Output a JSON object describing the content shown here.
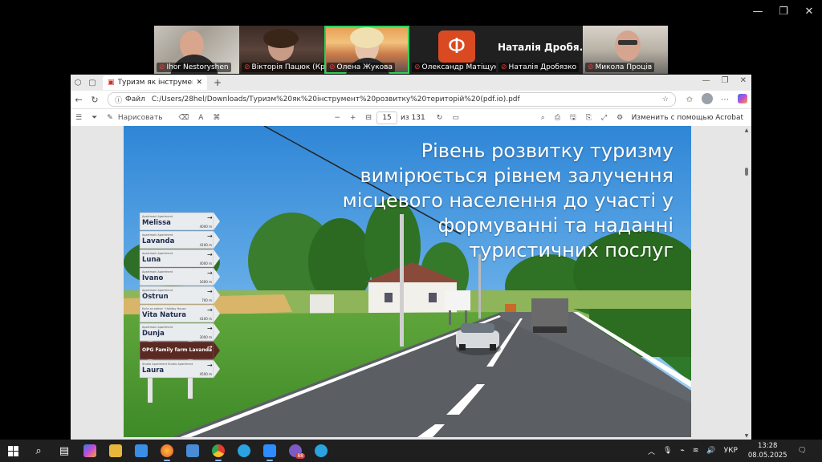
{
  "participants": [
    {
      "name": "Ihor Nestoryshen",
      "muted": true
    },
    {
      "name": "Вікторія Пацюк (Крив...",
      "muted": true
    },
    {
      "name": "Олена Жукова",
      "muted": true,
      "active": true
    },
    {
      "name": "Олександр Матіщук",
      "muted": true,
      "initial": "Ф"
    },
    {
      "name": "Наталія Дробязко",
      "muted": true,
      "display_name": "Наталія Дробя..."
    },
    {
      "name": "Микола Проців",
      "muted": true
    }
  ],
  "browser": {
    "tab_title": "Туризм як інструмент розвитку",
    "file_label": "Файл",
    "url": "C:/Users/28hel/Downloads/Туризм%20як%20інструмент%20розвитку%20територій%20(pdf.io).pdf"
  },
  "pdf_toolbar": {
    "draw_label": "Нарисовать",
    "page_current": "15",
    "page_total_label": "из 131",
    "acrobat_label": "Изменить с помощью Acrobat"
  },
  "slide": {
    "title": "Рівень розвитку туризму вимірюється рівнем залучення місцевого населення до участі у формуванні та наданні туристичних послуг",
    "sign_rows": [
      {
        "small": "Apartmani Apartment",
        "name": "Melissa",
        "dist": "4000 m"
      },
      {
        "small": "Apartmani Apartment",
        "name": "Lavanda",
        "dist": "4100 m"
      },
      {
        "small": "Apartmani Apartment",
        "name": "Luna",
        "dist": "4000 m"
      },
      {
        "small": "Apartmani Apartment",
        "name": "Ivano",
        "dist": "1600 m"
      },
      {
        "small": "Apartmani Apartment",
        "name": "Ostrun",
        "dist": "700 m"
      },
      {
        "small": "Kuća za odmor · Holiday House",
        "name": "Vita Natura",
        "dist": "4100 m"
      },
      {
        "small": "Apartmani Apartment",
        "name": "Dunja",
        "dist": "3000 m"
      },
      {
        "small": "",
        "name": "OPG Family farm Lavanda",
        "dist": ""
      },
      {
        "small": "Studio Apartment Studio Apartment",
        "name": "Laura",
        "dist": "4500 m"
      }
    ]
  },
  "taskbar": {
    "language": "УКР",
    "time": "13:28",
    "date": "08.05.2025",
    "viber_badge": "88"
  },
  "colors": {
    "zoom_active": "#2fd056",
    "taskbar_bg": "#1f1f1f",
    "sky": "#3a8ed8"
  }
}
